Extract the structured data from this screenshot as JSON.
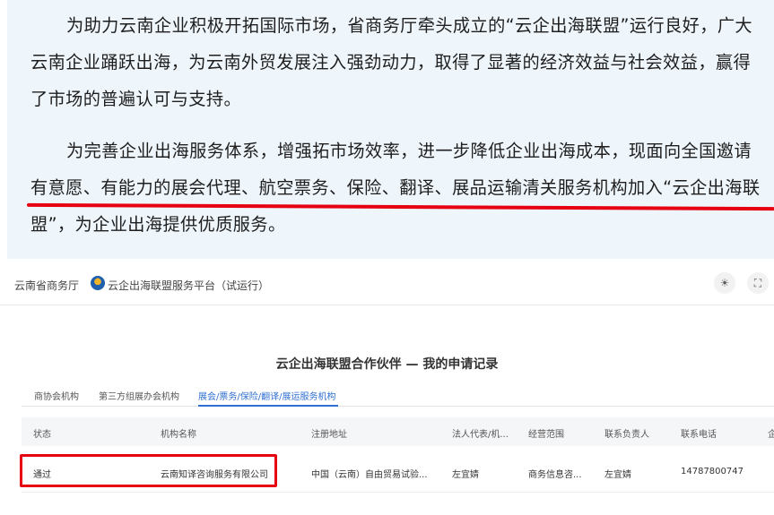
{
  "article": {
    "paragraph1": "为助力云南企业积极开拓国际市场，省商务厅牵头成立的“云企出海联盟”运行良好，广大云南企业踊跃出海，为云南外贸发展注入强劲动力，取得了显著的经济效益与社会效益，赢得了市场的普遍认可与支持。",
    "paragraph2": "为完善企业出海服务体系，增强拓市场效率，进一步降低企业出海成本，现面向全国邀请有意愿、有能力的展会代理、航空票务、保险、翻译、展品运输清关服务机构加入“云企出海联盟”，为企业出海提供优质服务。"
  },
  "header": {
    "org_name": "云南省商务厅",
    "platform_name": "云企出海联盟服务平台（试运行）",
    "icons": [
      "sun-icon",
      "expand-icon"
    ]
  },
  "main": {
    "title": "云企出海联盟合作伙伴 — 我的申请记录",
    "tabs": [
      {
        "label": "商协会机构"
      },
      {
        "label": "第三方组展办会机构"
      },
      {
        "label": "展会/票务/保险/翻译/展运服务机构",
        "active": true
      }
    ],
    "columns": [
      "状态",
      "机构名称",
      "注册地址",
      "法人代表/机...",
      "经营范围",
      "联系负责人",
      "联系电话",
      "企"
    ],
    "rows": [
      [
        "通过",
        "云南知译咨询服务有限公司",
        "中国（云南）自由贸易试验...",
        "左宜婧",
        "商务信息咨...",
        "左宜婧",
        "14787800747",
        ""
      ]
    ]
  },
  "colors": {
    "highlight_red": "#e60012",
    "accent_blue": "#2f6fd0",
    "article_bg": "#eef5fb"
  }
}
